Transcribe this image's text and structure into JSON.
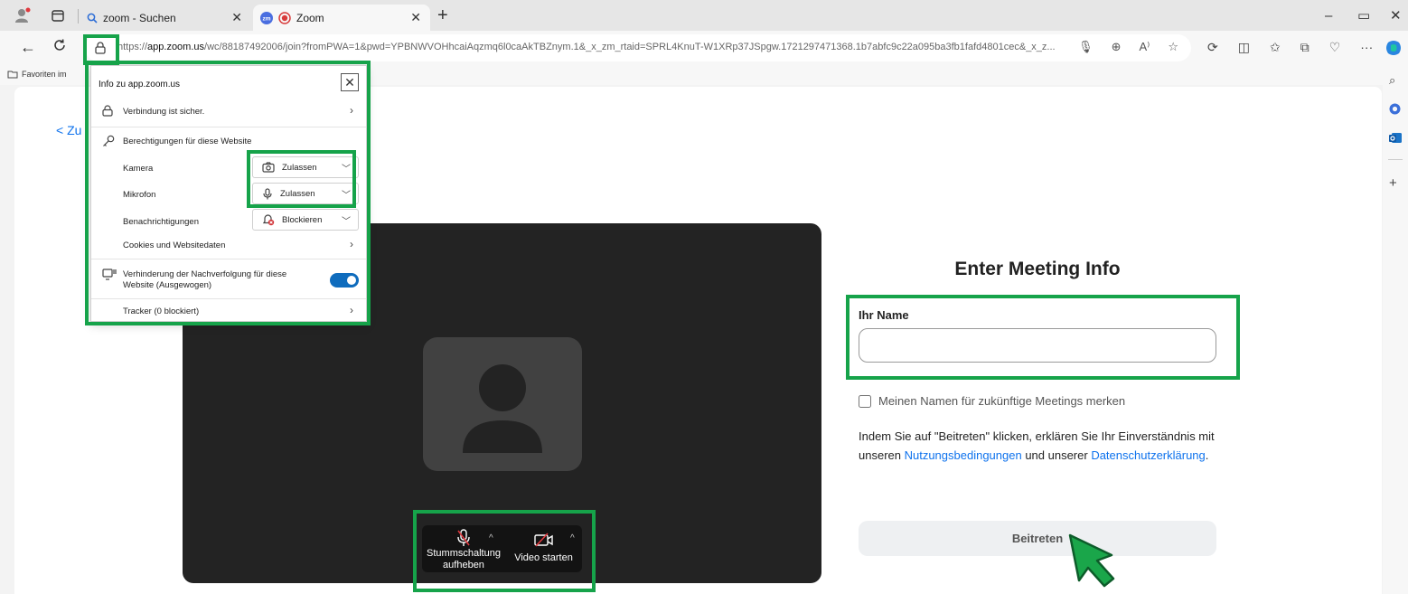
{
  "browser": {
    "tabs": [
      {
        "label": "zoom - Suchen",
        "active": false,
        "icon": "search-icon"
      },
      {
        "label": "Zoom",
        "active": true,
        "icon": "zoom-logo-icon",
        "recording": true
      }
    ],
    "url": {
      "prefix": "https://",
      "host": "app.zoom.us",
      "path": "/wc/88187492006/join?fromPWA=1&pwd=YPBNWVOHhcaiAqzmq6l0caAkTBZnym.1&_x_zm_rtaid=SPRL4KnuT-W1XRp37JSpgw.1721297471368.1b7abfc9c22a095ba3fb1fafd4801cec&_x_z..."
    },
    "favorites_label": "Favoriten im",
    "window_controls": {
      "minimize": "–",
      "restore": "▭",
      "close": "✕"
    }
  },
  "site_info": {
    "title": "Info zu app.zoom.us",
    "connection": "Verbindung ist sicher.",
    "permissions_header": "Berechtigungen für diese Website",
    "permissions": [
      {
        "label": "Kamera",
        "value": "Zulassen",
        "icon": "camera-icon"
      },
      {
        "label": "Mikrofon",
        "value": "Zulassen",
        "icon": "microphone-icon"
      },
      {
        "label": "Benachrichtigungen",
        "value": "Blockieren",
        "icon": "bell-blocked-icon"
      }
    ],
    "cookies": "Cookies und Websitedaten",
    "tracking_prevention": "Verhinderung der Nachverfolgung für diese Website (Ausgewogen)",
    "tracking_enabled": true,
    "trackers": "Tracker (0 blockiert)"
  },
  "page": {
    "back_link": "< Zu"
  },
  "meeting": {
    "title": "Enter Meeting Info",
    "name_label": "Ihr Name",
    "name_value": "",
    "remember_label": "Meinen Namen für zukünftige Meetings merken",
    "remember_checked": false,
    "legal_prefix": "Indem Sie auf \"Beitreten\" klicken, erklären Sie Ihr Einverständnis mit unseren ",
    "legal_link1": "Nutzungsbedingungen",
    "legal_middle": " und unserer ",
    "legal_link2": "Datenschutzerklärung",
    "legal_suffix": ".",
    "join_label": "Beitreten"
  },
  "preview_controls": {
    "unmute_label": "Stummschaltung aufheben",
    "video_label": "Video starten"
  },
  "colors": {
    "highlight": "#16a34a",
    "link": "#0e72ed",
    "preview_bg": "#232323",
    "toggle": "#0f6cbd"
  }
}
